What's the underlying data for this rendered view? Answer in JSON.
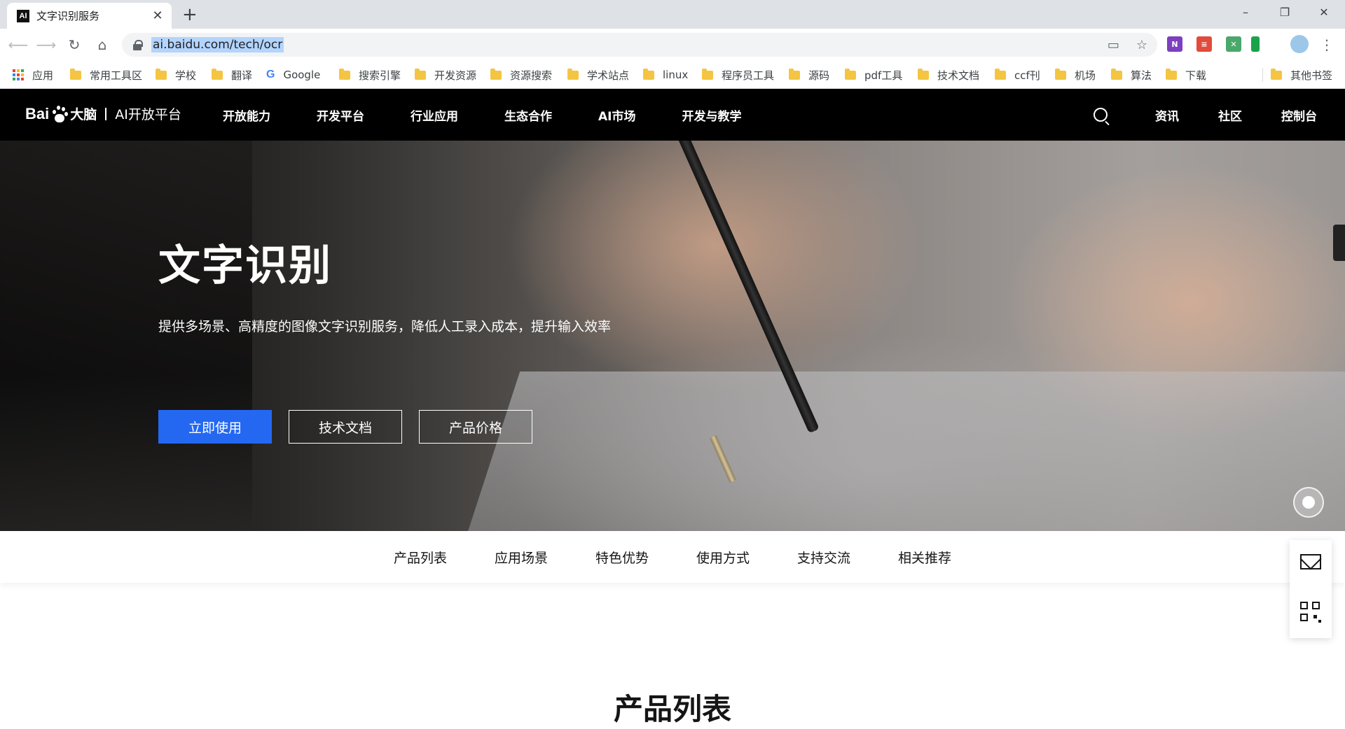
{
  "browser": {
    "tab": {
      "favicon_text": "AI",
      "title": "文字识别服务"
    },
    "new_tab_symbol": "+",
    "window_controls": [
      "–",
      "❐",
      "✕"
    ],
    "url": "ai.baidu.com/tech/ocr",
    "bookmarks": [
      "应用",
      "常用工具区",
      "学校",
      "翻译",
      "Google",
      "搜索引擎",
      "开发资源",
      "资源搜索",
      "学术站点",
      "linux",
      "程序员工具",
      "源码",
      "pdf工具",
      "技术文档",
      "ccf刊",
      "机场",
      "算法",
      "下载"
    ],
    "other_bookmarks": "其他书签"
  },
  "site": {
    "logo": {
      "bai": "Bai",
      "du": "du",
      "brain": "大脑",
      "platform": "AI开放平台"
    },
    "nav": [
      "开放能力",
      "开发平台",
      "行业应用",
      "生态合作",
      "AI市场",
      "开发与教学"
    ],
    "right_links": [
      "资讯",
      "社区",
      "控制台"
    ]
  },
  "hero": {
    "title": "文字识别",
    "subtitle": "提供多场景、高精度的图像文字识别服务，降低人工录入成本，提升输入效率",
    "buttons": [
      "立即使用",
      "技术文档",
      "产品价格"
    ]
  },
  "sub_nav": [
    "产品列表",
    "应用场景",
    "特色优势",
    "使用方式",
    "支持交流",
    "相关推荐"
  ],
  "section_title": "产品列表",
  "colors": {
    "primary": "#2468f2",
    "header_bg": "#000000",
    "folder": "#f4c542"
  }
}
